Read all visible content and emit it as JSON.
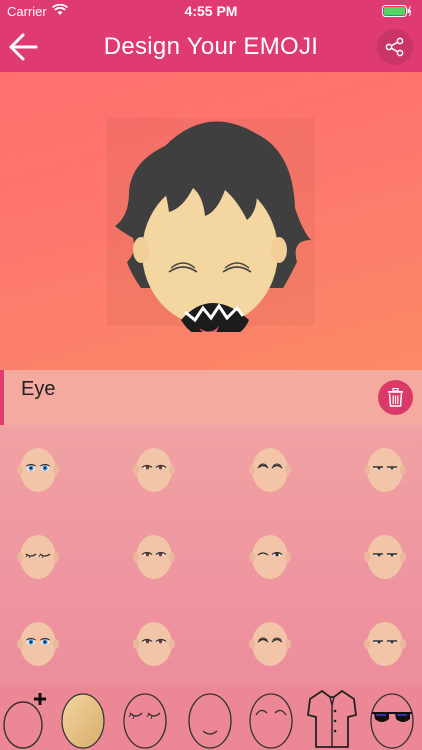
{
  "status_bar": {
    "carrier": "Carrier",
    "time": "4:55 PM"
  },
  "nav": {
    "title": "Design Your EMOJI",
    "back_icon": "back-arrow-icon",
    "share_icon": "share-icon"
  },
  "category": {
    "label": "Eye",
    "delete_icon": "trash-icon"
  },
  "colors": {
    "accent": "#e03a72",
    "skin": "#f4d6a0",
    "hair": "#3f3f3f"
  },
  "eye_options": [
    {
      "style": "blue-open"
    },
    {
      "style": "brown-open"
    },
    {
      "style": "happy-closed"
    },
    {
      "style": "sleepy-half"
    },
    {
      "style": "closed-lashes"
    },
    {
      "style": "brown-open"
    },
    {
      "style": "wink"
    },
    {
      "style": "sleepy-half"
    },
    {
      "style": "blue-open"
    },
    {
      "style": "brown-open"
    },
    {
      "style": "happy-closed"
    },
    {
      "style": "sleepy-half"
    }
  ],
  "toolbar_items": [
    {
      "name": "add-face"
    },
    {
      "name": "skin-color"
    },
    {
      "name": "eyes"
    },
    {
      "name": "mouth"
    },
    {
      "name": "eyebrows"
    },
    {
      "name": "shirt"
    },
    {
      "name": "glasses"
    }
  ]
}
